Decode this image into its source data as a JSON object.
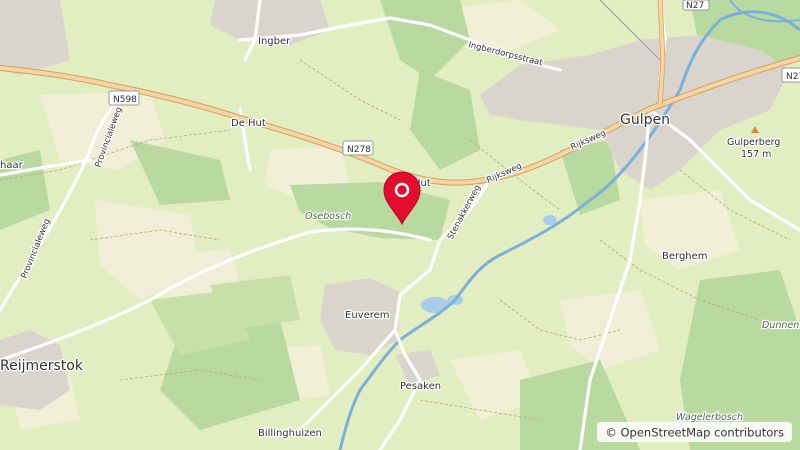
{
  "map": {
    "center_label": "Osebosch",
    "places": {
      "ingber": "Ingber",
      "de_hut": "De Hut",
      "gulpen": "Gulpen",
      "euverem": "Euverem",
      "pesaken": "Pesaken",
      "berghem": "Berghem",
      "reijmerstok": "Reijmerstok",
      "billinghuizen": "Billinghuizen",
      "haar_partial": "haar",
      "gulperberg": "Gulperberg",
      "gulperberg_elev": "157 m",
      "hut_partial": "Hut"
    },
    "woods": {
      "osebosch": "Osebosch",
      "dunnenbosch_partial": "Dunnen",
      "wagelerbosch_partial": "Wagelerbosch"
    },
    "roads": {
      "ingberdorpsstraat": "Ingberdorpsstraat",
      "rijksweg": "Rijksweg",
      "provincialeweg_left": "Provincialeweg",
      "provincialeweg_upper": "Provincialeweg",
      "stenakkerweg": "Stenakkerweg"
    },
    "shields": {
      "n598": "N598",
      "n278": "N278",
      "n27_partial": "N27",
      "n27_partial_2": "N27"
    },
    "marker": {
      "icon": "location-pin-icon",
      "color": "#e30b2e"
    },
    "attribution": {
      "symbol": "©",
      "text": "OpenStreetMap contributors"
    }
  }
}
